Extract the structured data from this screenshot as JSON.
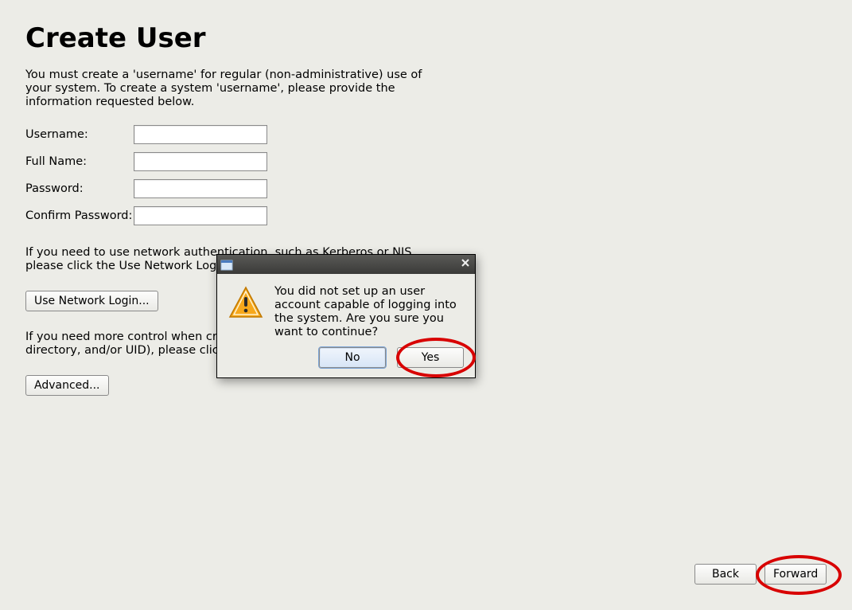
{
  "page": {
    "title": "Create User",
    "intro": "You must create a 'username' for regular (non-administrative) use of your system.  To create a system 'username', please provide the information requested below.",
    "fields": {
      "username": {
        "label": "Username:",
        "value": ""
      },
      "fullname": {
        "label": "Full Name:",
        "value": ""
      },
      "password": {
        "label": "Password:",
        "value": ""
      },
      "confirm": {
        "label": "Confirm Password:",
        "value": ""
      }
    },
    "netauth_para": "If you need to use network authentication, such as Kerberos or NIS, please click the Use Network Login button.",
    "use_network_login_label": "Use Network Login...",
    "advanced_para": "If you need more control when creating the user (specifying home directory, and/or UID), please click the Advanced button.",
    "advanced_label": "Advanced...",
    "nav": {
      "back": "Back",
      "forward": "Forward"
    }
  },
  "dialog": {
    "message": "You did not set up an user account capable of logging into the system. Are you sure you want to continue?",
    "no_label": "No",
    "yes_label": "Yes"
  }
}
